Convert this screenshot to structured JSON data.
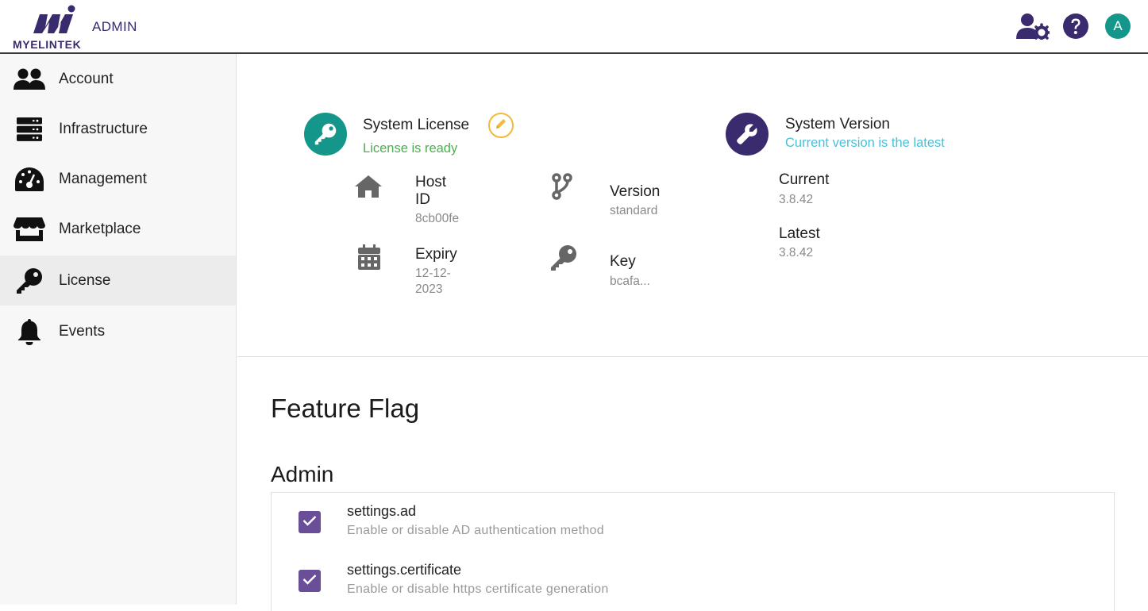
{
  "header": {
    "brand": "MYELINTEK",
    "section": "ADMIN",
    "avatar_initial": "A",
    "icons": [
      "user-gear-icon",
      "help-icon"
    ]
  },
  "sidebar": {
    "items": [
      {
        "label": "Account",
        "icon": "users-icon"
      },
      {
        "label": "Infrastructure",
        "icon": "server-icon"
      },
      {
        "label": "Management",
        "icon": "gauge-icon"
      },
      {
        "label": "Marketplace",
        "icon": "store-icon"
      },
      {
        "label": "License",
        "icon": "key-icon",
        "active": true
      },
      {
        "label": "Events",
        "icon": "bell-icon"
      }
    ]
  },
  "license": {
    "title": "System License",
    "status": "License is ready",
    "host_id_label": "Host ID",
    "host_id_value": "8cb00fe",
    "expiry_label": "Expiry",
    "expiry_value": "12-12-2023",
    "version_label": "Version",
    "version_value": "standard",
    "key_label": "Key",
    "key_value": "bcafa..."
  },
  "version": {
    "title": "System Version",
    "status": "Current version is the latest",
    "current_label": "Current",
    "current_value": "3.8.42",
    "latest_label": "Latest",
    "latest_value": "3.8.42"
  },
  "feature_flag": {
    "title": "Feature Flag",
    "group": "Admin",
    "flags": [
      {
        "name": "settings.ad",
        "description": "Enable or disable AD authentication method",
        "checked": true
      },
      {
        "name": "settings.certificate",
        "description": "Enable or disable https certificate generation",
        "checked": true
      }
    ]
  },
  "colors": {
    "brand_purple": "#3a2a6e",
    "teal": "#14978a",
    "ready_green": "#4caf50",
    "latest_cyan": "#4ac0d8",
    "checkbox_purple": "#6a4e98"
  }
}
